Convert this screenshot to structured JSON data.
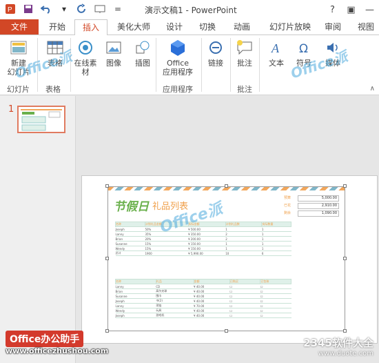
{
  "window": {
    "title": "演示文稿1 - PowerPoint",
    "controls": [
      "?",
      "▣",
      "—"
    ]
  },
  "tabs": {
    "file": "文件",
    "items": [
      "开始",
      "插入",
      "美化大师",
      "设计",
      "切换",
      "动画",
      "幻灯片放映",
      "审阅",
      "视图"
    ],
    "active": "插入"
  },
  "ribbon": {
    "new_slide": "新建\n幻灯片",
    "table": "表格",
    "online": "在线素\n材",
    "image": "图像",
    "illustration": "插图",
    "office_apps": "Office\n应用程序",
    "link": "链接",
    "comment": "批注",
    "text": "文本",
    "symbol": "符号",
    "media": "媒体",
    "groups": {
      "slides": "幻灯片",
      "tables": "表格",
      "apps": "应用程序",
      "comments": "批注"
    }
  },
  "thumbnail": {
    "number": "1"
  },
  "sheet": {
    "title": "节假日",
    "subtitle": "礼品列表",
    "money_rows": [
      {
        "label": "预算",
        "value": "5,000.00"
      },
      {
        "label": "已花",
        "value": "2,910.00"
      },
      {
        "label": "剩余",
        "value": "1,090.00"
      }
    ],
    "table1_headers": [
      "名称",
      "计划礼品金额",
      "实际金额",
      "计划礼品数",
      "实际数量"
    ],
    "table1_rows": [
      [
        "Joseph",
        "50%",
        "¥ 500.00",
        "1",
        "1"
      ],
      [
        "Lanny",
        "35%",
        "¥ 350.00",
        "2",
        "1"
      ],
      [
        "Brian",
        "20%",
        "¥ 200.00",
        "2",
        "1"
      ],
      [
        "Susanne",
        "15%",
        "¥ 150.00",
        "1",
        "1"
      ],
      [
        "Wendy",
        "15%",
        "¥ 150.00",
        "1",
        "1"
      ],
      [
        "总计",
        "1900",
        "¥ 5,990.00",
        "10",
        "6"
      ]
    ],
    "table2_headers": [
      "名称",
      "礼品",
      "金额",
      "已购买",
      "已包装"
    ],
    "table2_rows": [
      [
        "Lanny",
        "CD",
        "¥ 40.00",
        "☐",
        "☐"
      ],
      [
        "Brian",
        "高尔夫球",
        "¥ 40.00",
        "☐",
        "☐"
      ],
      [
        "Susanne",
        "围巾",
        "¥ 40.00",
        "☐",
        "☐"
      ],
      [
        "Joseph",
        "书(2)",
        "¥ 40.00",
        "☐",
        "☐"
      ],
      [
        "Lanny",
        "项链",
        "¥ 70.00",
        "☐",
        "☐"
      ],
      [
        "Wendy",
        "玩具",
        "¥ 40.00",
        "☐",
        "☐"
      ],
      [
        "Joseph",
        "游戏机",
        "¥ 40.00",
        "☐",
        "☐"
      ]
    ]
  },
  "watermarks": {
    "office_badge": "Office办公助手",
    "url": "www.officezhushou.com",
    "site_big": "2345软件大全",
    "site_small": "www.duote.com",
    "overlay": "Office派"
  },
  "colors": {
    "accent": "#d24726",
    "sheet_green": "#6ab04c",
    "sheet_orange": "#f0a04b"
  }
}
